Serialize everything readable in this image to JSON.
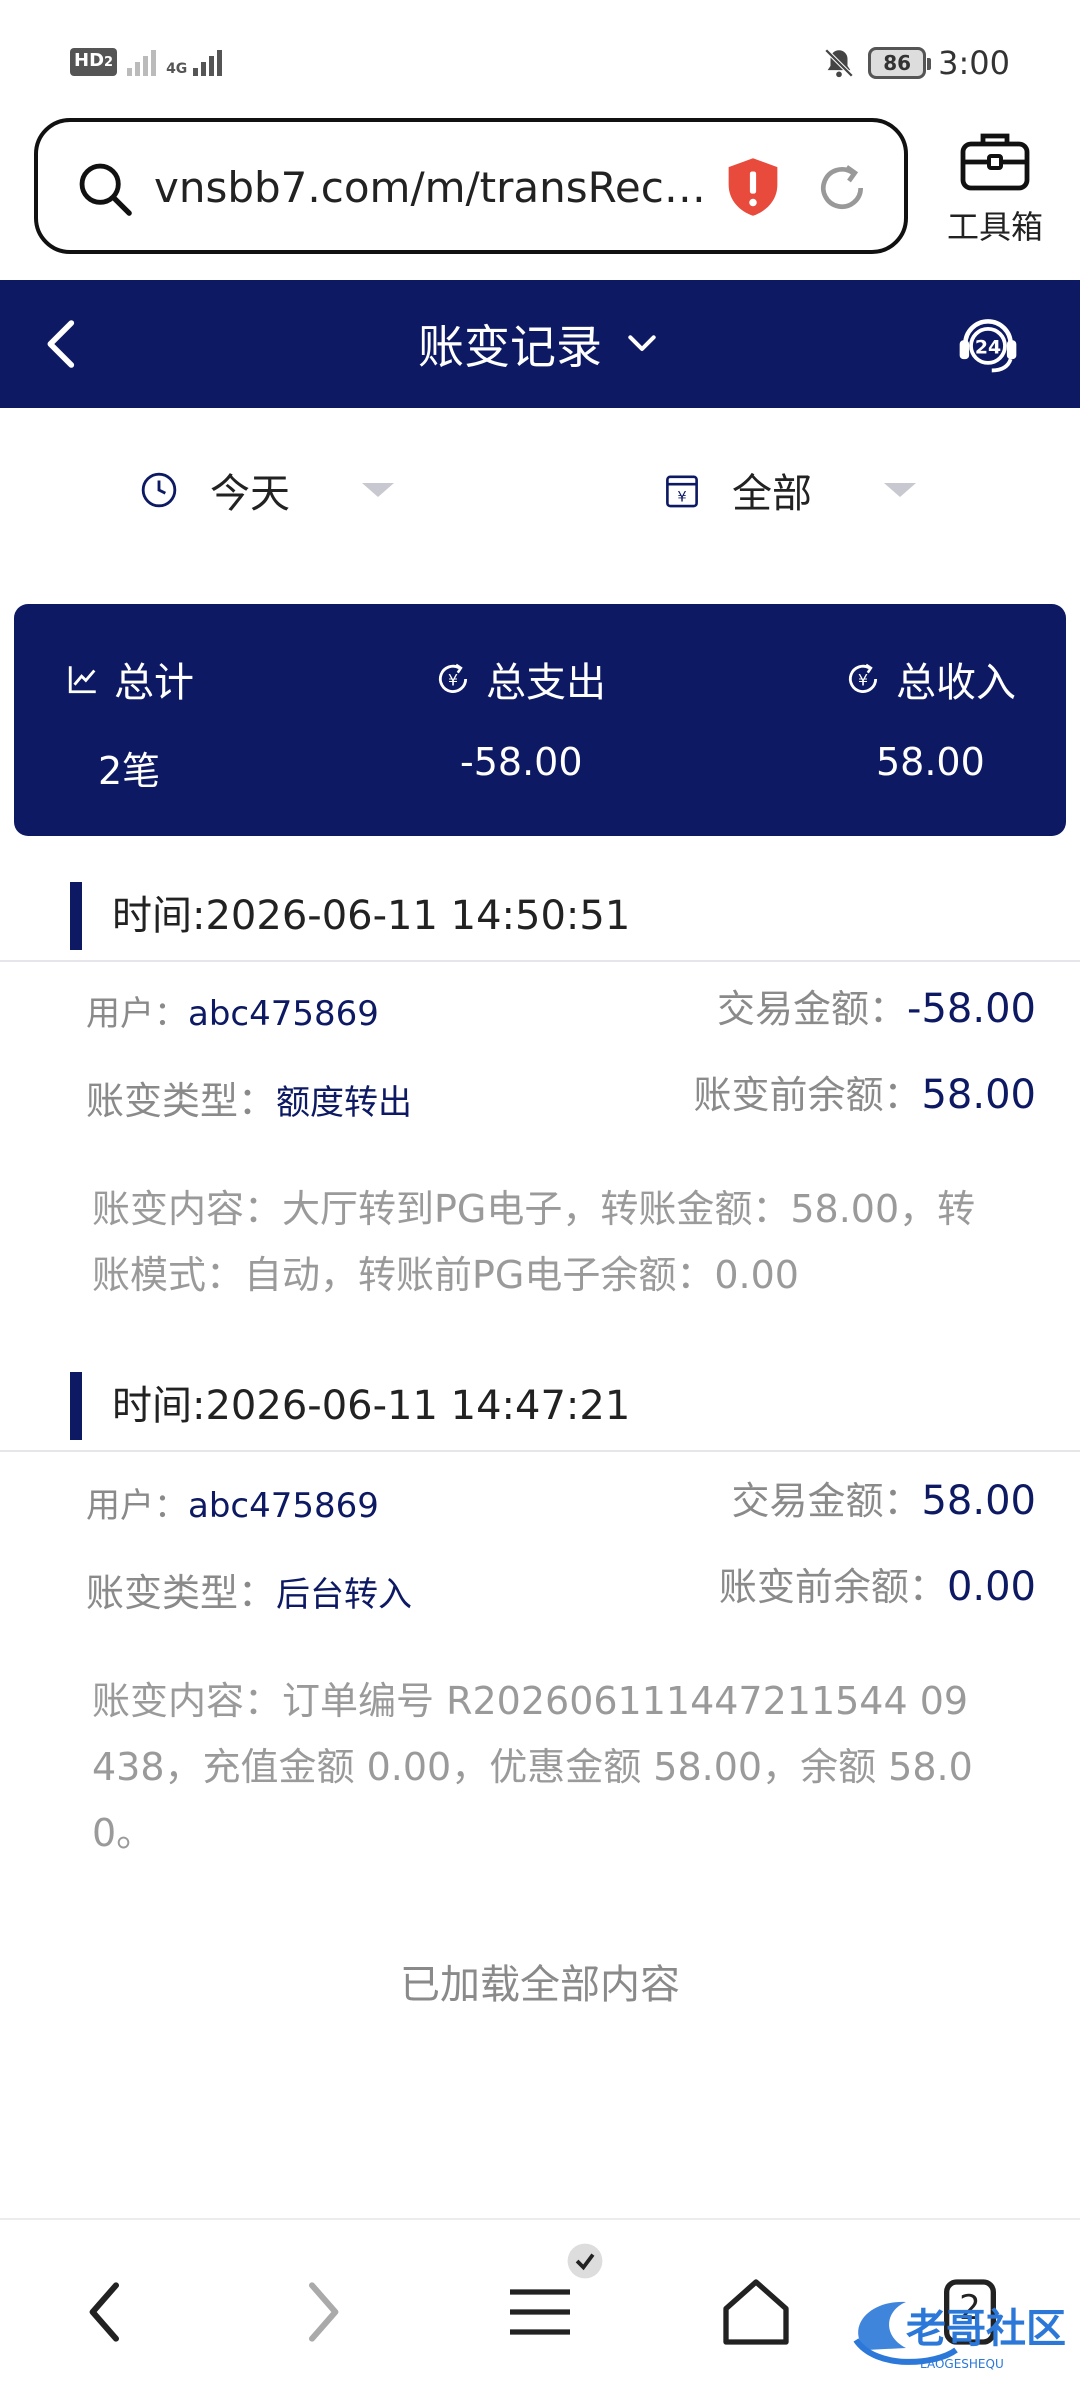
{
  "status_bar": {
    "hd_label": "HD",
    "hd_sub": "2",
    "network": "4G",
    "battery": "86",
    "time": "3:00"
  },
  "browser": {
    "url": "vnsbb7.com/m/transReco...",
    "toolbox_label": "工具箱"
  },
  "header": {
    "title": "账变记录"
  },
  "filters": {
    "date": "今天",
    "type": "全部"
  },
  "summary": {
    "total_label": "总计",
    "total_value": "2笔",
    "expense_label": "总支出",
    "expense_value": "-58.00",
    "income_label": "总收入",
    "income_value": "58.00"
  },
  "records": [
    {
      "time": "时间:2026-06-11 14:50:51",
      "user_label": "用户：",
      "user": "abc475869",
      "amount_label": "交易金额：",
      "amount": "-58.00",
      "type_label": "账变类型：",
      "type": "额度转出",
      "before_label": "账变前余额：",
      "before": "58.00",
      "content": "账变内容：大厅转到PG电子，转账金额：58.00，转账模式：自动，转账前PG电子余额：0.00"
    },
    {
      "time": "时间:2026-06-11 14:47:21",
      "user_label": "用户：",
      "user": "abc475869",
      "amount_label": "交易金额：",
      "amount": "58.00",
      "type_label": "账变类型：",
      "type": "后台转入",
      "before_label": "账变前余额：",
      "before": "0.00",
      "content": "账变内容：订单编号 R202606111447211544 09438，充值金额 0.00，优惠金额 58.00，余额 58.00。"
    }
  ],
  "footer": {
    "loaded_text": "已加载全部内容"
  },
  "bottom_nav": {
    "tab_count": "2"
  },
  "watermark": {
    "text": "老哥社区",
    "sub": "LAOGESHEQU"
  },
  "colors": {
    "brand": "#0d1a63",
    "muted": "#8a8a8a",
    "shield": "#e84a3c"
  }
}
